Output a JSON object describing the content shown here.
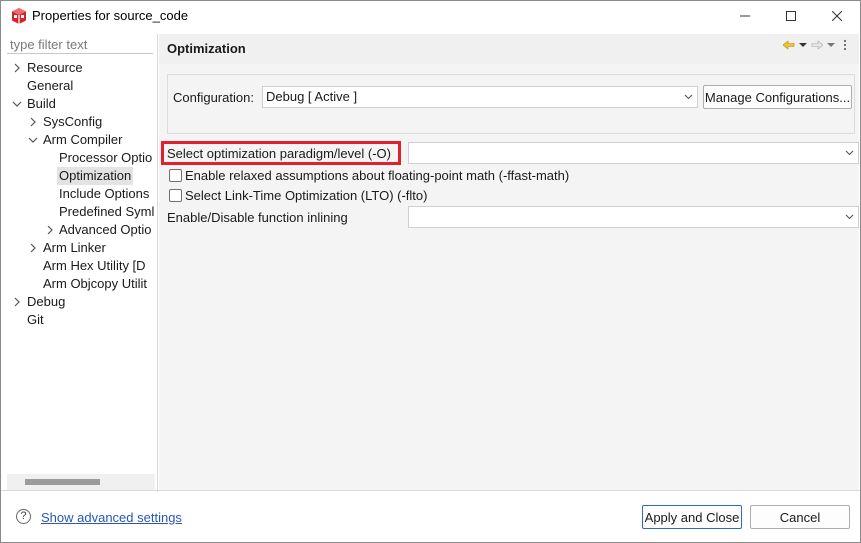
{
  "window": {
    "title": "Properties for source_code",
    "minimize_icon": "minimize-icon",
    "maximize_icon": "maximize-icon",
    "close_icon": "close-icon"
  },
  "filter": {
    "placeholder": "type filter text"
  },
  "tree": {
    "items": [
      {
        "label": "Resource",
        "twisty": "collapsed"
      },
      {
        "label": "General",
        "twisty": "none"
      },
      {
        "label": "Build",
        "twisty": "expanded"
      },
      {
        "label": "SysConfig",
        "twisty": "collapsed"
      },
      {
        "label": "Arm Compiler",
        "twisty": "expanded"
      },
      {
        "label": "Processor Optio",
        "twisty": "none"
      },
      {
        "label": "Optimization",
        "twisty": "none",
        "selected": true
      },
      {
        "label": "Include Options",
        "twisty": "none"
      },
      {
        "label": "Predefined Syml",
        "twisty": "none"
      },
      {
        "label": "Advanced Optio",
        "twisty": "collapsed"
      },
      {
        "label": "Arm Linker",
        "twisty": "collapsed"
      },
      {
        "label": "Arm Hex Utility  [D",
        "twisty": "none"
      },
      {
        "label": "Arm Objcopy Utilit",
        "twisty": "none"
      },
      {
        "label": "Debug",
        "twisty": "collapsed"
      },
      {
        "label": "Git",
        "twisty": "none"
      }
    ]
  },
  "page": {
    "title": "Optimization",
    "nav_icons": [
      "back-icon",
      "back-menu-icon",
      "forward-icon",
      "forward-menu-icon",
      "view-menu-icon"
    ]
  },
  "configuration": {
    "label": "Configuration:",
    "value": "Debug  [ Active ]",
    "manage_button": "Manage Configurations..."
  },
  "options": {
    "opt_level_label": "Select optimization paradigm/level (-O)",
    "opt_level_value": "",
    "fast_math_label": "Enable relaxed assumptions about floating-point math (-ffast-math)",
    "fast_math_checked": false,
    "lto_label": "Select Link-Time Optimization (LTO) (-flto)",
    "lto_checked": false,
    "inlining_label": "Enable/Disable function inlining",
    "inlining_value": ""
  },
  "footer": {
    "help_icon": "help-icon",
    "advanced_link": "Show advanced settings",
    "apply_close": "Apply and Close",
    "cancel": "Cancel"
  },
  "colors": {
    "highlight_box": "#e0202c",
    "link": "#2a56b8",
    "selection": "#e3e3e3",
    "app_icon": "#d2232a"
  }
}
